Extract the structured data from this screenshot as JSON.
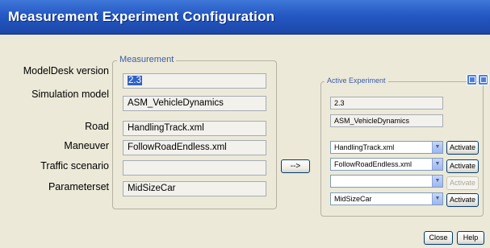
{
  "window": {
    "title": "Measurement Experiment Configuration"
  },
  "labels": {
    "modeldesk_version": "ModelDesk version",
    "simulation_model": "Simulation model",
    "road": "Road",
    "maneuver": "Maneuver",
    "traffic_scenario": "Traffic scenario",
    "parameterset": "Parameterset"
  },
  "measurement": {
    "group_title": "Measurement",
    "modeldesk_version": "2.3",
    "simulation_model": "ASM_VehicleDynamics",
    "road": "HandlingTrack.xml",
    "maneuver": "FollowRoadEndless.xml",
    "traffic_scenario": "",
    "parameterset": "MidSizeCar"
  },
  "transfer_button": "-->",
  "active_experiment": {
    "group_title": "Active Experiment",
    "modeldesk_version": "2.3",
    "simulation_model": "ASM_VehicleDynamics",
    "road": "HandlingTrack.xml",
    "maneuver": "FollowRoadEndless.xml",
    "traffic_scenario": "",
    "parameterset": "MidSizeCar",
    "activate_label": "Activate"
  },
  "footer": {
    "close": "Close",
    "help": "Help"
  }
}
